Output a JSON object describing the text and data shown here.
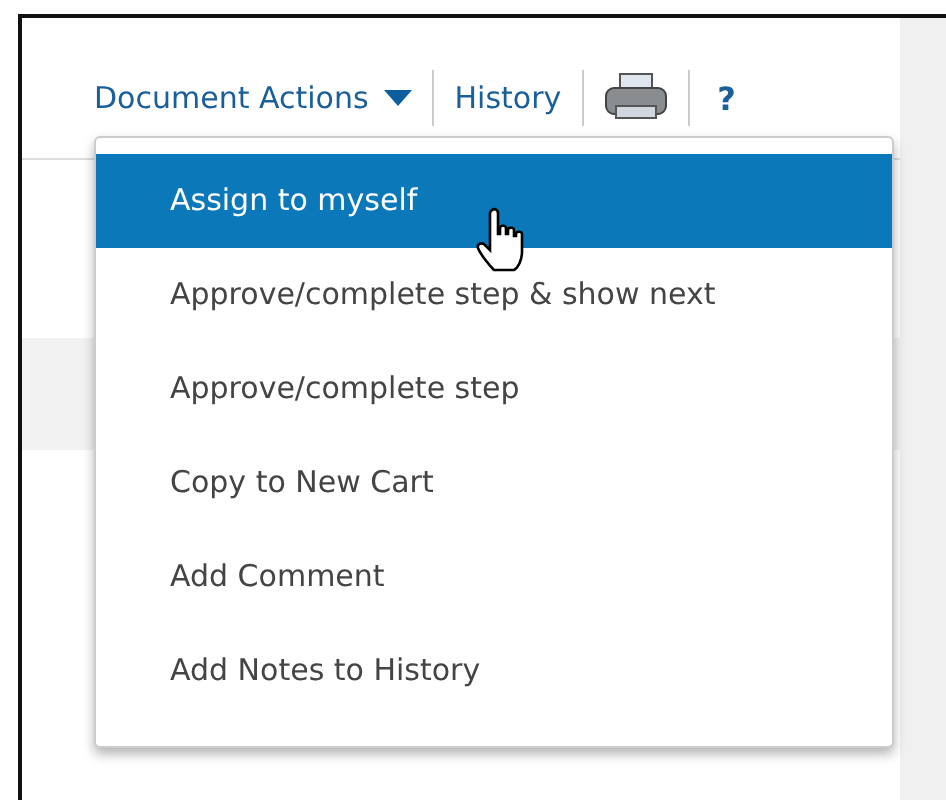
{
  "toolbar": {
    "document_actions": {
      "label": "Document Actions",
      "expanded": true
    },
    "history": "History",
    "help": "?"
  },
  "menu": {
    "items": [
      {
        "label": "Assign to myself",
        "selected": true
      },
      {
        "label": "Approve/complete step & show next",
        "selected": false
      },
      {
        "label": "Approve/complete step",
        "selected": false
      },
      {
        "label": "Copy to New Cart",
        "selected": false
      },
      {
        "label": "Add Comment",
        "selected": false
      },
      {
        "label": "Add Notes to History",
        "selected": false
      }
    ]
  }
}
